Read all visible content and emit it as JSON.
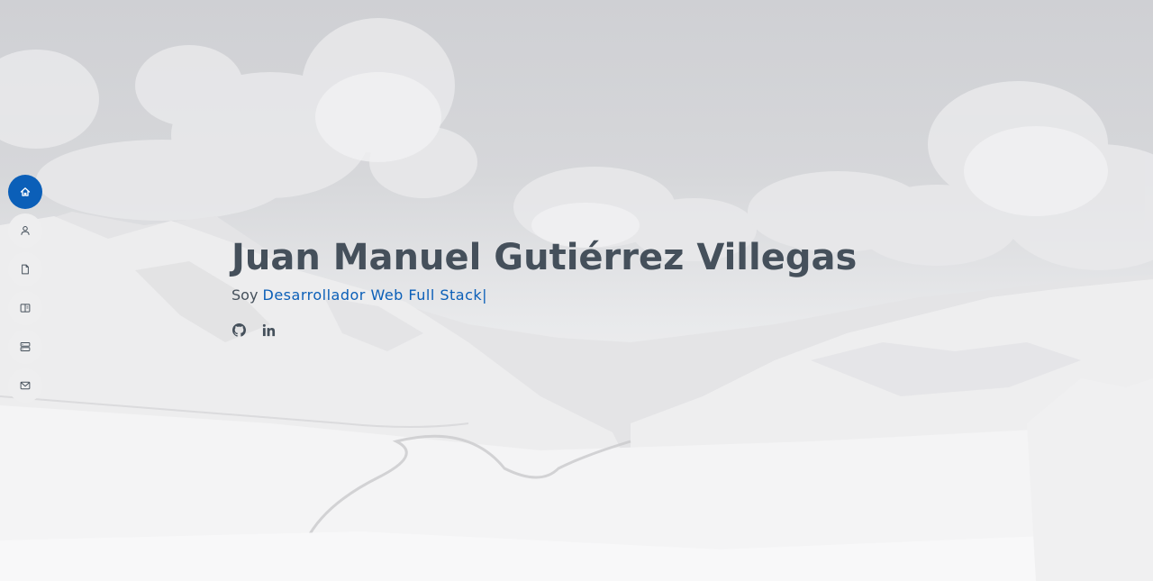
{
  "hero": {
    "name": "Juan Manuel Gutiérrez Villegas",
    "intro": "Soy",
    "role": "Desarrollador Web Full Stack",
    "cursor": "|"
  },
  "nav": {
    "items": [
      {
        "icon": "home-icon",
        "active": true
      },
      {
        "icon": "person-icon",
        "active": false
      },
      {
        "icon": "file-icon",
        "active": false
      },
      {
        "icon": "book-icon",
        "active": false
      },
      {
        "icon": "server-icon",
        "active": false
      },
      {
        "icon": "envelope-icon",
        "active": false
      }
    ]
  },
  "social": [
    {
      "icon": "github-icon"
    },
    {
      "icon": "linkedin-icon"
    }
  ],
  "colors": {
    "accent": "#0b5fb8",
    "text": "#45505b",
    "nav_bg": "#eeeeef"
  }
}
